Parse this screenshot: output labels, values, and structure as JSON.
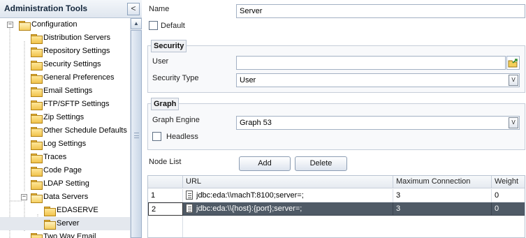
{
  "sidebar": {
    "title": "Administration Tools",
    "collapse_glyph": "<",
    "tree": [
      {
        "label": "Configuration",
        "expanded": true
      },
      {
        "label": "Distribution Servers"
      },
      {
        "label": "Repository Settings"
      },
      {
        "label": "Security Settings"
      },
      {
        "label": "General Preferences"
      },
      {
        "label": "Email Settings"
      },
      {
        "label": "FTP/SFTP Settings"
      },
      {
        "label": "Zip Settings"
      },
      {
        "label": "Other Schedule Defaults"
      },
      {
        "label": "Log Settings"
      },
      {
        "label": "Traces"
      },
      {
        "label": "Code Page"
      },
      {
        "label": "LDAP Setting"
      },
      {
        "label": "Data Servers",
        "expanded": true
      },
      {
        "label": "EDASERVE"
      },
      {
        "label": "Server",
        "selected": true
      },
      {
        "label": "Two Way Email"
      }
    ]
  },
  "form": {
    "name_label": "Name",
    "name_value": "Server",
    "default_label": "Default",
    "default_checked": false,
    "security": {
      "legend": "Security",
      "user_label": "User",
      "user_value": "",
      "security_type_label": "Security Type",
      "security_type_value": "User"
    },
    "graph": {
      "legend": "Graph",
      "engine_label": "Graph Engine",
      "engine_value": "Graph 53",
      "headless_label": "Headless",
      "headless_checked": false
    },
    "node_list": {
      "label": "Node List",
      "add_label": "Add",
      "delete_label": "Delete",
      "columns": [
        "URL",
        "Maximum Connection",
        "Weight"
      ],
      "rows": [
        {
          "num": "1",
          "url": "jdbc:eda:\\\\machT:8100;server=;",
          "max": "3",
          "weight": "0",
          "selected": false
        },
        {
          "num": "2",
          "url": "jdbc:eda:\\\\{host}:{port};server=;",
          "max": "3",
          "weight": "0",
          "selected": true
        }
      ]
    }
  },
  "colors": {
    "selected_row": "#4f5a66",
    "panel_border": "#b9c6d6",
    "folder": "#f0c24b"
  },
  "icons": {
    "collapse": "chevron-left-icon",
    "folder": "folder-icon",
    "browse": "browse-icon",
    "dropdown": "chevron-down-icon",
    "url": "document-icon"
  }
}
